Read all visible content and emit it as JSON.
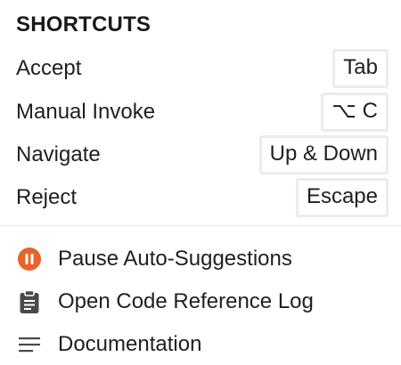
{
  "shortcuts": {
    "title": "SHORTCUTS",
    "items": [
      {
        "label": "Accept",
        "key": "Tab"
      },
      {
        "label": "Manual Invoke",
        "key": "⌥ C"
      },
      {
        "label": "Navigate",
        "key": "Up & Down"
      },
      {
        "label": "Reject",
        "key": "Escape"
      }
    ]
  },
  "menu": {
    "items": [
      {
        "label": "Pause Auto-Suggestions",
        "icon": "pause-icon",
        "color": "#e8632a"
      },
      {
        "label": "Open Code Reference Log",
        "icon": "clipboard-icon",
        "color": "#4a4a4a"
      },
      {
        "label": "Documentation",
        "icon": "lines-icon",
        "color": "#4a4a4a"
      }
    ]
  }
}
